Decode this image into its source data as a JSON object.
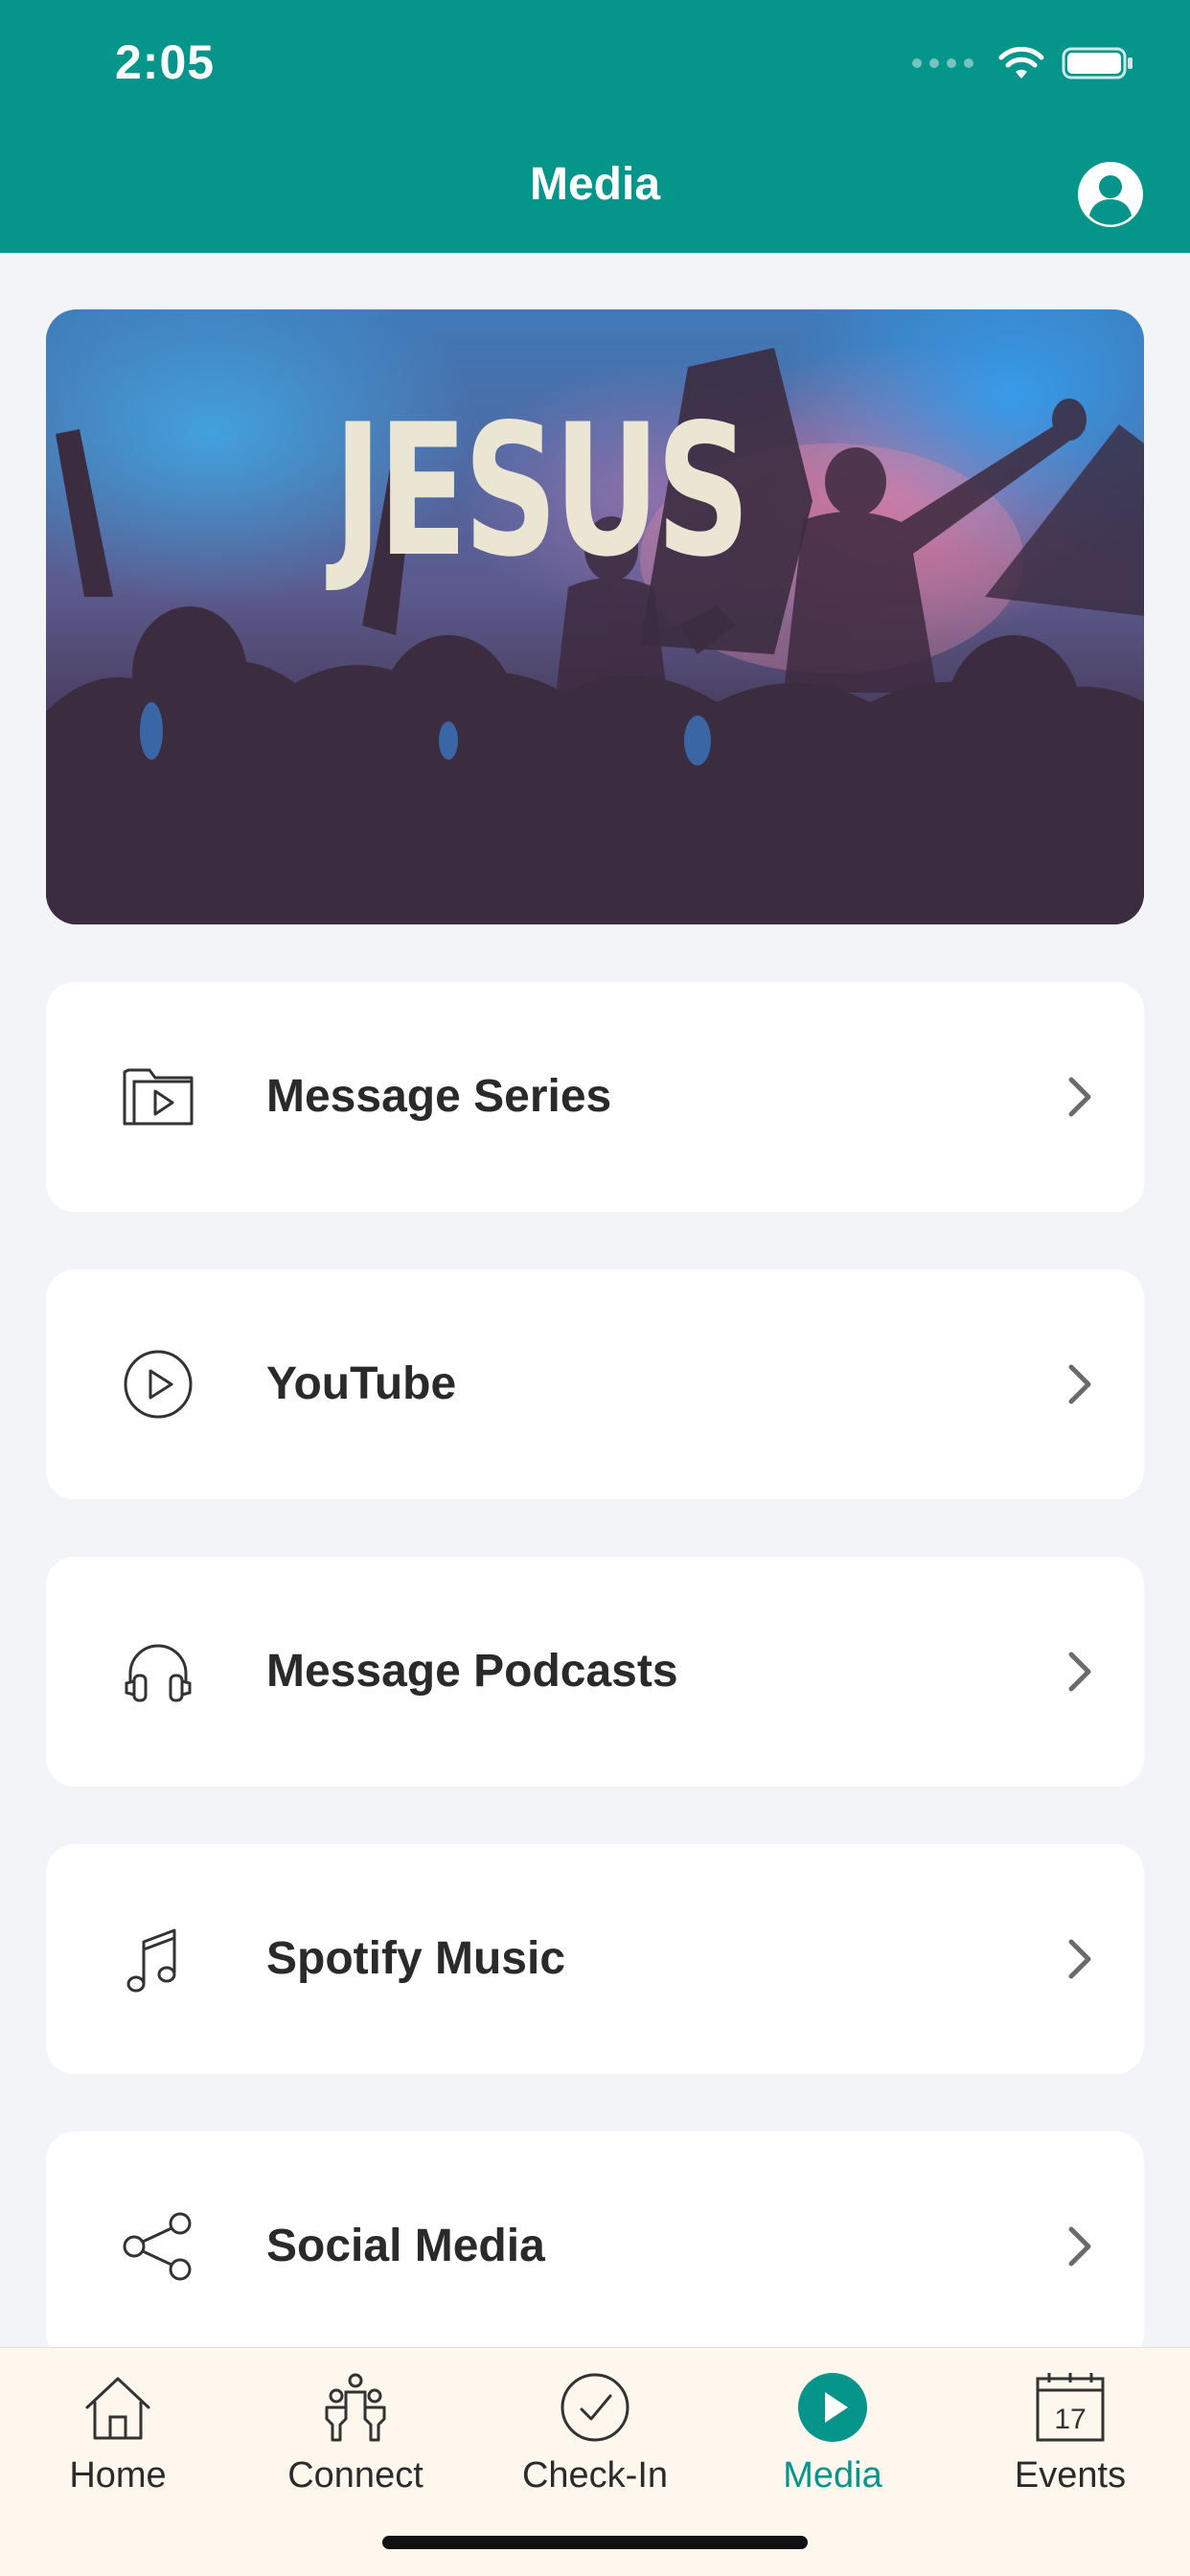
{
  "status_bar": {
    "time": "2:05"
  },
  "nav": {
    "title": "Media"
  },
  "hero": {
    "text": "JESUS"
  },
  "menu": [
    {
      "label": "Message Series",
      "icon": "video-folder-icon"
    },
    {
      "label": "YouTube",
      "icon": "play-circle-icon"
    },
    {
      "label": "Message Podcasts",
      "icon": "headphones-icon"
    },
    {
      "label": "Spotify Music",
      "icon": "music-note-icon"
    },
    {
      "label": "Social Media",
      "icon": "share-icon"
    }
  ],
  "tabs": [
    {
      "label": "Home",
      "icon": "home-icon",
      "active": false
    },
    {
      "label": "Connect",
      "icon": "people-icon",
      "active": false
    },
    {
      "label": "Check-In",
      "icon": "check-circle-icon",
      "active": false
    },
    {
      "label": "Media",
      "icon": "play-filled-icon",
      "active": true
    },
    {
      "label": "Events",
      "icon": "calendar-icon",
      "active": false,
      "badge": "17"
    }
  ],
  "colors": {
    "accent": "#05958b",
    "background": "#f2f4f7",
    "tabbar": "#fdf7ee",
    "text": "#2a2a2a"
  }
}
